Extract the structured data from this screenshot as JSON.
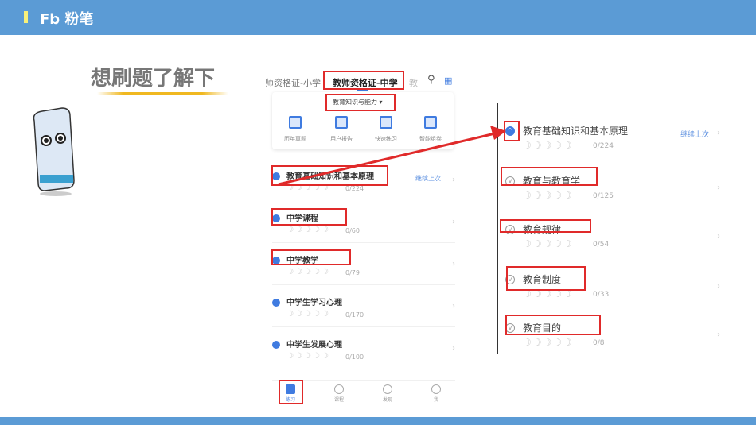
{
  "header": {
    "brand": "Fb 粉笔"
  },
  "slide": {
    "title": "想刷题了解下"
  },
  "phone": {
    "tabs": [
      "师资格证-小学",
      "教师资格证-中学",
      "教"
    ],
    "subject": "教育知识与能力",
    "tools": [
      "历年真题",
      "用户报告",
      "快速练习",
      "智能组卷"
    ],
    "continue_label": "继续上次",
    "items": [
      {
        "name": "教育基础知识和基本原理",
        "count": "0/224"
      },
      {
        "name": "中学课程",
        "count": "0/60"
      },
      {
        "name": "中学教学",
        "count": "0/79"
      },
      {
        "name": "中学生学习心理",
        "count": "0/170"
      },
      {
        "name": "中学生发展心理",
        "count": "0/100"
      }
    ],
    "nav": [
      "练习",
      "课程",
      "发现",
      "我"
    ]
  },
  "detail": {
    "continue_label": "继续上次",
    "items": [
      {
        "name": "教育基础知识和基本原理",
        "count": "0/224"
      },
      {
        "name": "教育与教育学",
        "count": "0/125"
      },
      {
        "name": "教育规律",
        "count": "0/54"
      },
      {
        "name": "教育制度",
        "count": "0/33"
      },
      {
        "name": "教育目的",
        "count": "0/8"
      }
    ]
  },
  "colors": {
    "header": "#5b9bd5",
    "accent": "#3f7be0",
    "highlight": "#e02a2a"
  }
}
